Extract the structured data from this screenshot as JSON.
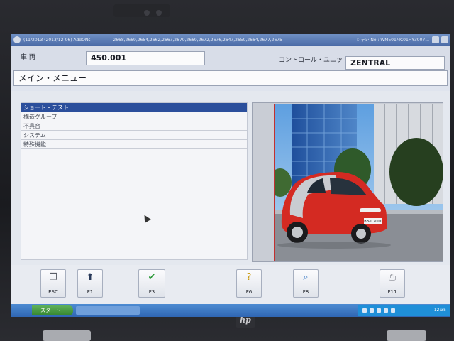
{
  "window": {
    "title_left": "(11/2013 (2013/12-06)  AddONs",
    "title_mid": "2668,2669,2654,2662,2667,2670,2669,2672,2676,2647,2650,2664,2677,2675",
    "title_right": "シャシ No.: WME01MC01HY3007..."
  },
  "header": {
    "vehicle_label": "車 両",
    "vehicle_value": "450.001",
    "control_unit_label": "コントロール・ユニット",
    "control_unit_value": "ZENTRAL"
  },
  "menu": {
    "title": "メイン・メニュー"
  },
  "list": {
    "items": [
      {
        "label": "ショート・テスト",
        "selected": true
      },
      {
        "label": "構造グループ",
        "selected": false
      },
      {
        "label": "不具合",
        "selected": false
      },
      {
        "label": "システム",
        "selected": false
      },
      {
        "label": "特殊機能",
        "selected": false
      }
    ]
  },
  "image": {
    "description_icon": "red-smart-car-photo",
    "plate": "BB-T 7000"
  },
  "toolbar": {
    "buttons": [
      {
        "key": "ESC",
        "icon": "exit-icon"
      },
      {
        "key": "F1",
        "icon": "home-arrow-icon"
      },
      {
        "key": "F3",
        "icon": "checkmark-icon"
      },
      {
        "key": "F6",
        "icon": "help-icon"
      },
      {
        "key": "F8",
        "icon": "magnifier-icon"
      },
      {
        "key": "F11",
        "icon": "printer-icon"
      }
    ]
  },
  "taskbar": {
    "start_label": "スタート",
    "task_label": "",
    "clock": "12:35"
  },
  "colors": {
    "selection": "#2b4f9c",
    "titlebar": "#4a6aa6",
    "taskbar": "#2f66b3",
    "car_body": "#d42a22"
  }
}
